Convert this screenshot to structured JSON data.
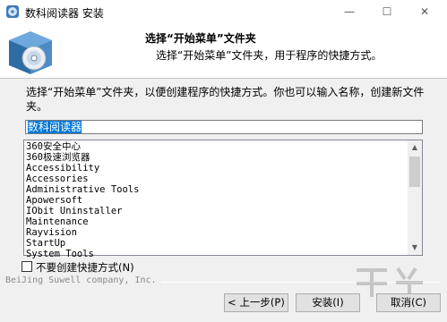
{
  "window": {
    "title": "数科阅读器 安装",
    "controls": {
      "minimize": "—",
      "maximize": "☐",
      "close": "✕"
    }
  },
  "header": {
    "title": "选择“开始菜单”文件夹",
    "subtitle": "选择“开始菜单”文件夹，用于程序的快捷方式。"
  },
  "body": {
    "instruction": "选择“开始菜单”文件夹，以便创建程序的快捷方式。你也可以输入名称，创建新文件夹。",
    "folder_input": "数科阅读器",
    "folders": [
      "360安全中心",
      "360极速浏览器",
      "Accessibility",
      "Accessories",
      "Administrative Tools",
      "Apowersoft",
      "IObit Uninstaller",
      "Maintenance",
      "Rayvision",
      "StartUp",
      "System Tools"
    ],
    "no_shortcuts_label": "不要创建快捷方式(N)",
    "no_shortcuts_checked": false
  },
  "footer": {
    "company": "BeiJing Suwell company, Inc.",
    "back_label": "< 上一步(P)",
    "install_label": "安装(I)",
    "cancel_label": "取消(C)"
  },
  "icons": {
    "app": "installer-disc-icon",
    "header_logo": "installer-box-disc-icon"
  }
}
